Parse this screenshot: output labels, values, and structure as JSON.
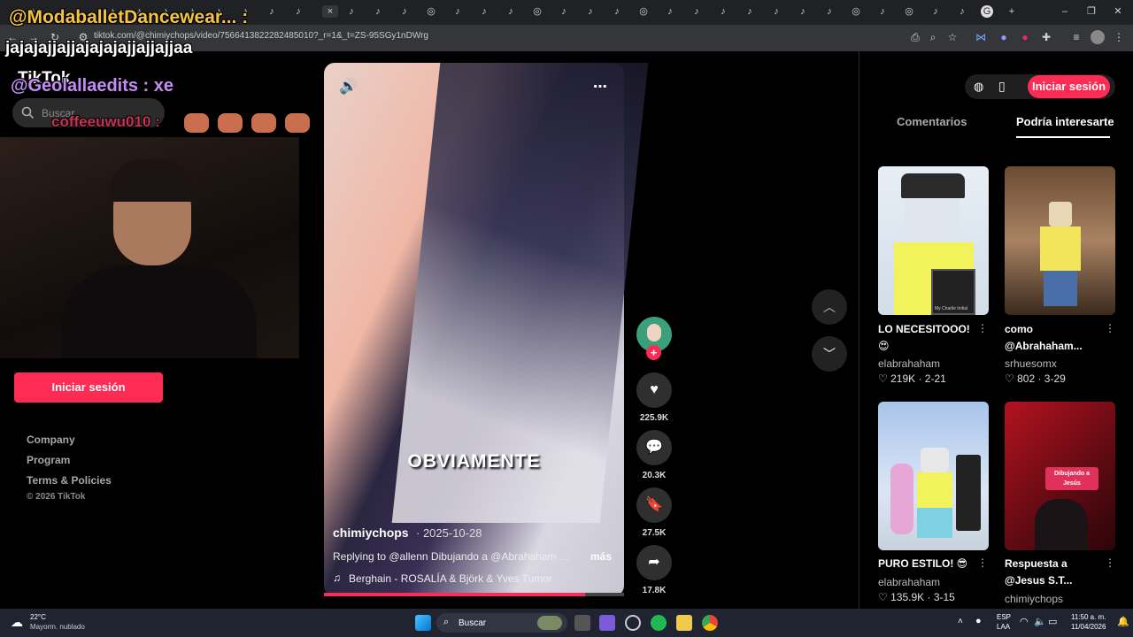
{
  "browser": {
    "active_tab_close": "×",
    "new_tab": "+",
    "url": "tiktok.com/@chimiychops/video/7566413822282485010?_r=1&_t=ZS-95SGy1nDWrg",
    "window_controls": [
      "–",
      "❐",
      "✕"
    ]
  },
  "stream_overlay": {
    "line1": "@ModaballetDancewear... :",
    "line2": "jajajajjajjajajajajjajjajjaa",
    "line3": "@Geolallaedits : xe",
    "line4": "coffeeuwu010 :"
  },
  "tiktok": {
    "logo": "TikTok",
    "search_placeholder": "Buscar",
    "login_left": "Iniciar sesión",
    "footer_links": [
      "Company",
      "Program",
      "Terms & Policies"
    ],
    "copyright": "© 2026 TikTok"
  },
  "video": {
    "overlay_text": "OBVIAMENTE",
    "author": "chimiychops",
    "date": "· 2025-10-28",
    "caption": "Replying to @allenn Dibujando a @Abrahaham ...",
    "more": "más",
    "music": "Berghain - ROSALÍA & Björk & Yves Tumor",
    "progress": 0.87,
    "likes": "225.9K",
    "comments": "20.3K",
    "saves": "27.5K",
    "shares": "17.8K"
  },
  "right_panel": {
    "login": "Iniciar sesión",
    "tabs": [
      "Comentarios",
      "Podría interesarte"
    ],
    "cards": [
      {
        "title": "LO NECESITOOO! 😍",
        "user": "elabrahaham",
        "likes": "219K",
        "date": "2-21",
        "thumb_label": "My Charlie Initial"
      },
      {
        "title": "como @Abrahaham...",
        "user": "srhuesomx",
        "likes": "802",
        "date": "3-29"
      },
      {
        "title": "PURO ESTILO! 😎",
        "user": "elabrahaham",
        "likes": "135.9K",
        "date": "3-15"
      },
      {
        "title": "Respuesta a @Jesus S.T...",
        "user": "chimiychops",
        "likes": "",
        "date": "",
        "thumb_label": "Dibujando a Jesús"
      }
    ]
  },
  "taskbar": {
    "temperature": "22°C",
    "weather": "Mayorm. nublado",
    "search": "Buscar",
    "lang": "ESP",
    "lang2": "LAA",
    "time": "11:50 a. m.",
    "date": "11/04/2026"
  },
  "colors": {
    "accent": "#fe2c55",
    "background": "#000000"
  }
}
